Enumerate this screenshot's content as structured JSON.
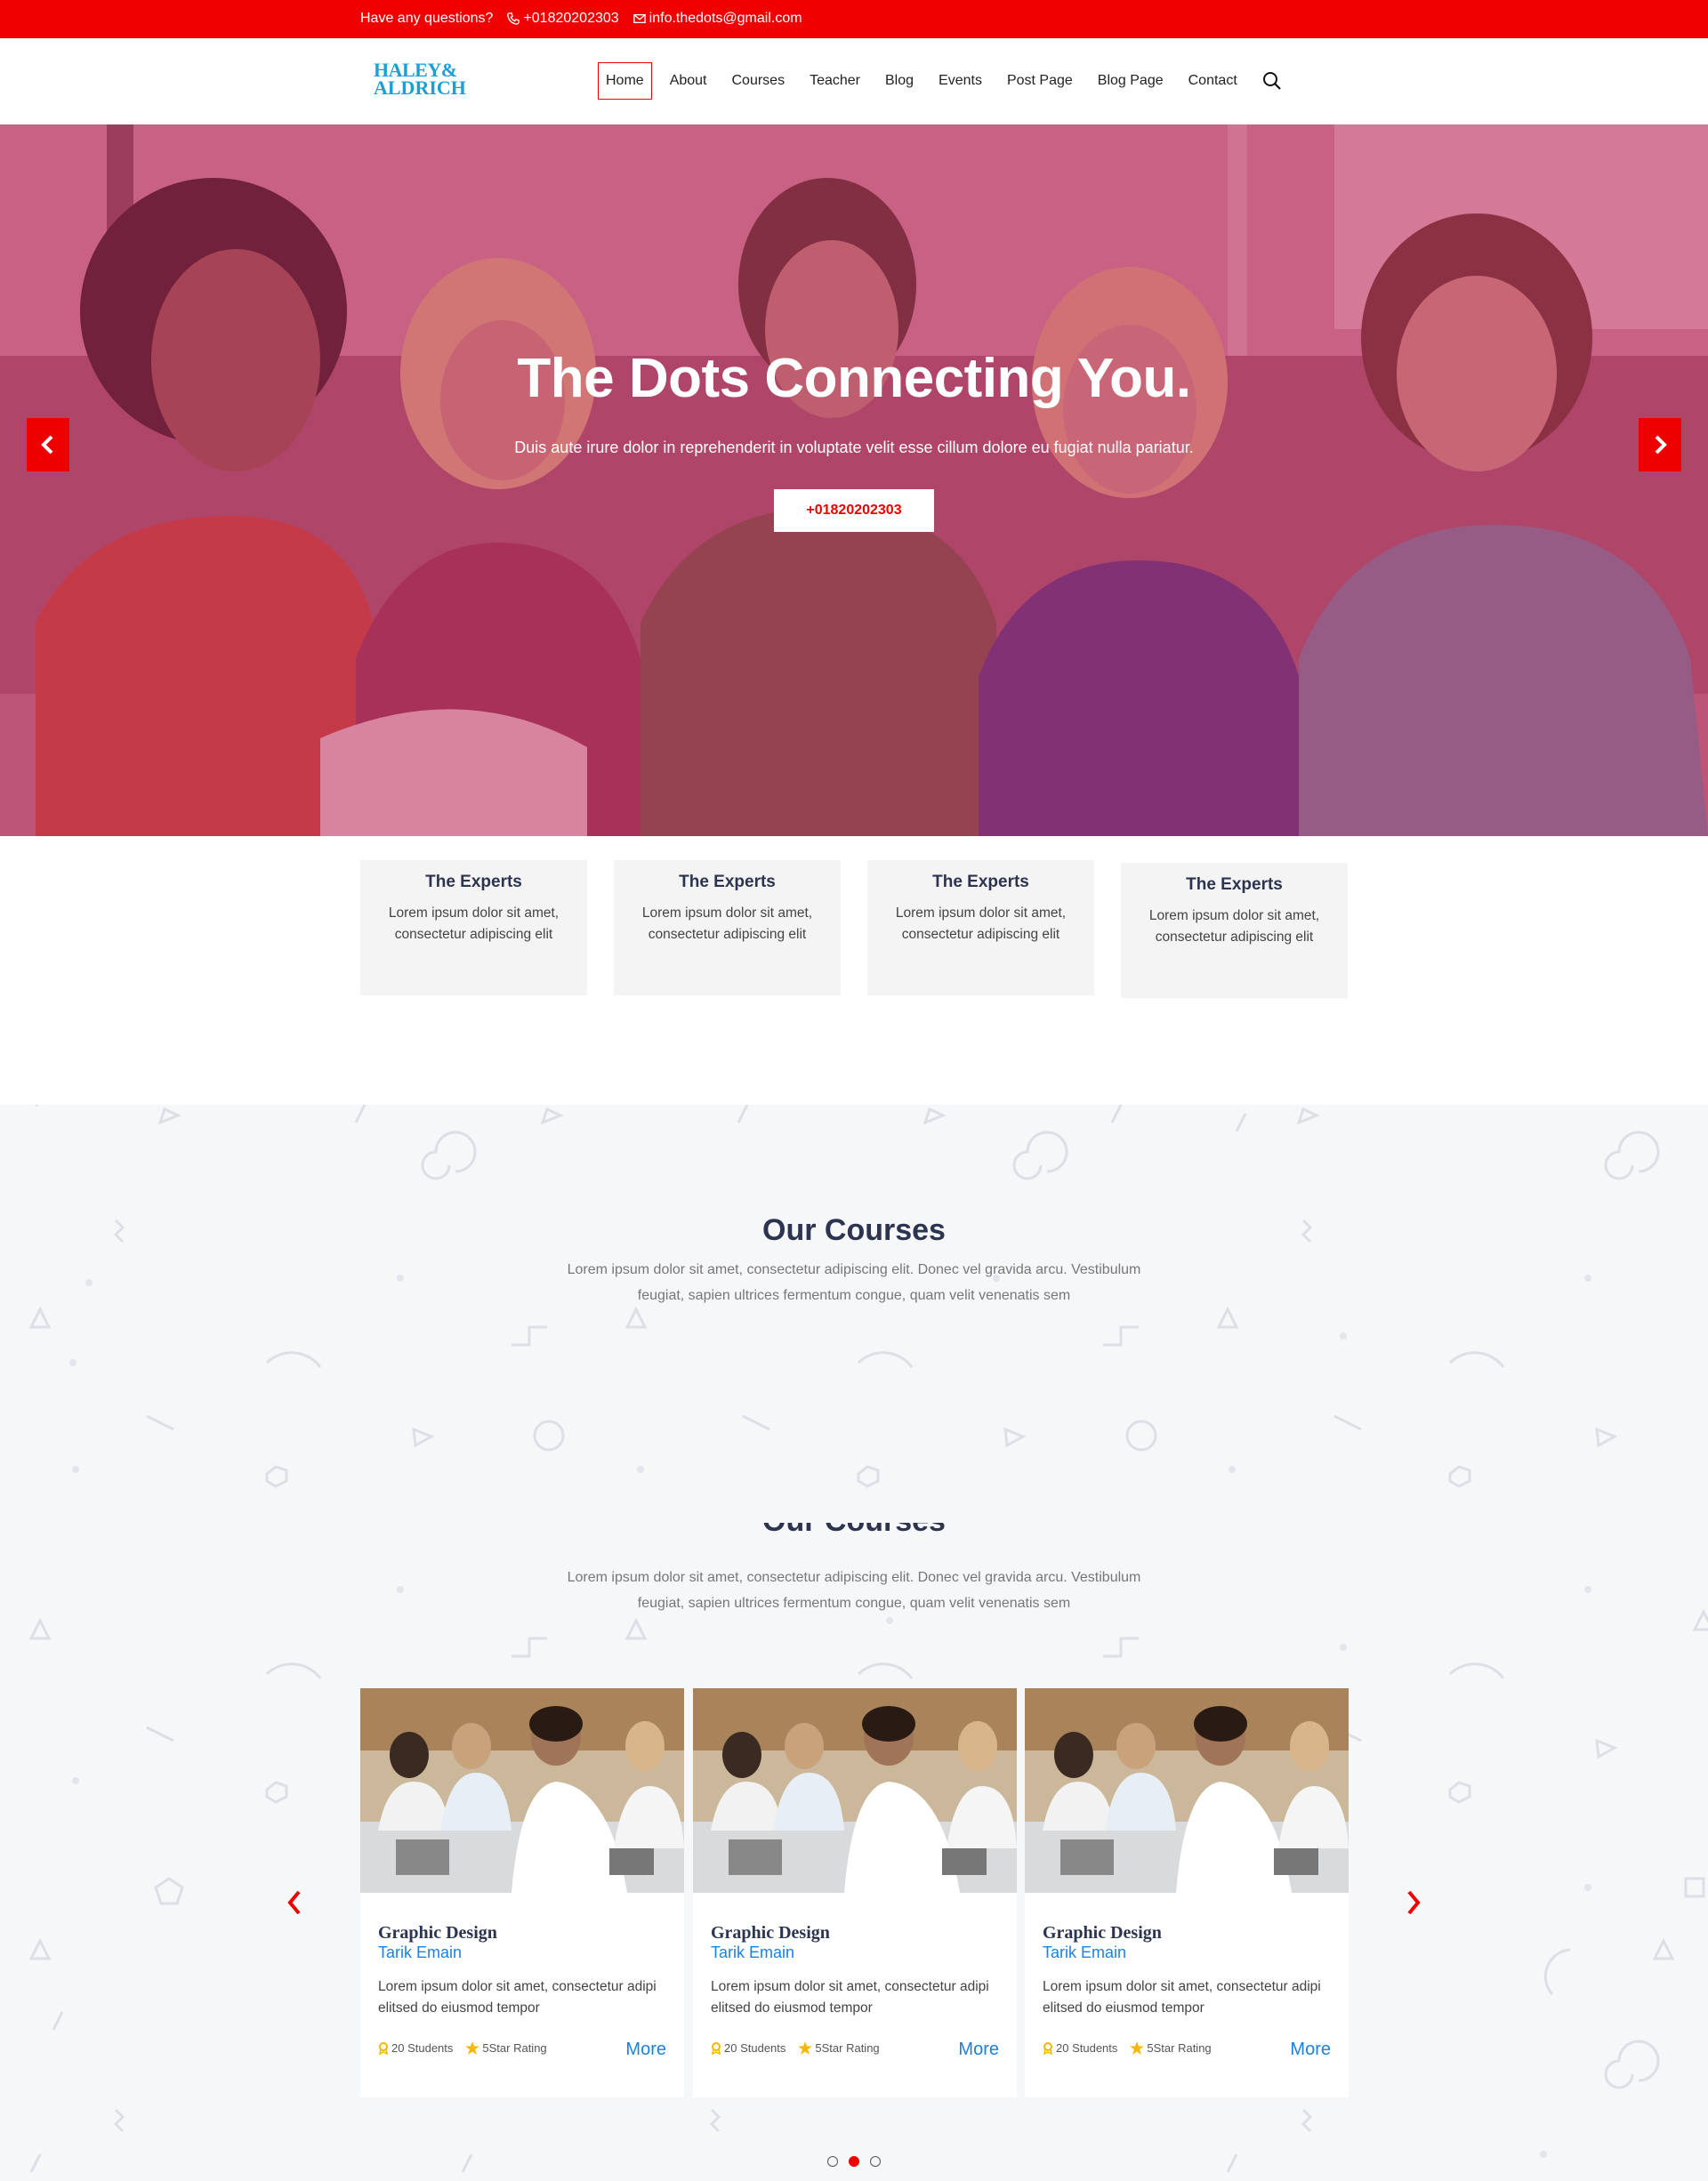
{
  "topbar": {
    "question": "Have any questions?",
    "phone": "+01820202303",
    "email": "info.thedots@gmail.com"
  },
  "brand": {
    "line1": "HALEY&",
    "line2": "ALDRICH",
    "color": "#1b9fd8"
  },
  "nav": {
    "items": [
      "Home",
      "About",
      "Courses",
      "Teacher",
      "Blog",
      "Events",
      "Post Page",
      "Blog Page",
      "Contact"
    ],
    "active": "Home",
    "search_icon": "search-icon"
  },
  "hero": {
    "title": "The Dots Connecting You.",
    "subtitle": "Duis aute irure dolor in reprehenderit in voluptate velit esse cillum dolore eu fugiat nulla pariatur.",
    "cta": "+01820202303",
    "prev_icon": "chevron-left-icon",
    "next_icon": "chevron-right-icon"
  },
  "features": [
    {
      "title": "The Experts",
      "text": "Lorem ipsum dolor sit amet, consectetur adipiscing elit"
    },
    {
      "title": "The Experts",
      "text": "Lorem ipsum dolor sit amet, consectetur adipiscing elit"
    },
    {
      "title": "The Experts",
      "text": "Lorem ipsum dolor sit amet, consectetur adipiscing elit"
    },
    {
      "title": "The Experts",
      "text": "Lorem ipsum dolor sit amet, consectetur adipiscing elit"
    }
  ],
  "courses": {
    "title": "Our Courses",
    "subtitle": "Lorem ipsum dolor sit amet, consectetur adipiscing elit. Donec vel gravida arcu. Vestibulum feugiat, sapien ultrices fermentum congue, quam velit venenatis sem",
    "cards": [
      {
        "title": "Graphic Design",
        "author": "Tarik Emain",
        "desc": "Lorem ipsum dolor sit amet, consectetur adipi elitsed do eiusmod tempor",
        "students": "20 Students",
        "rating": "5Star Rating",
        "more": "More"
      },
      {
        "title": "Graphic Design",
        "author": "Tarik Emain",
        "desc": "Lorem ipsum dolor sit amet, consectetur adipi elitsed do eiusmod tempor",
        "students": "20 Students",
        "rating": "5Star Rating",
        "more": "More"
      },
      {
        "title": "Graphic Design",
        "author": "Tarik Emain",
        "desc": "Lorem ipsum dolor sit amet, consectetur adipi elitsed do eiusmod tempor",
        "students": "20 Students",
        "rating": "5Star Rating",
        "more": "More"
      }
    ],
    "pager": {
      "count": 3,
      "active_index": 1
    }
  },
  "colors": {
    "accent": "#f00000",
    "link": "#1a82e2",
    "heading": "#2c3450"
  }
}
